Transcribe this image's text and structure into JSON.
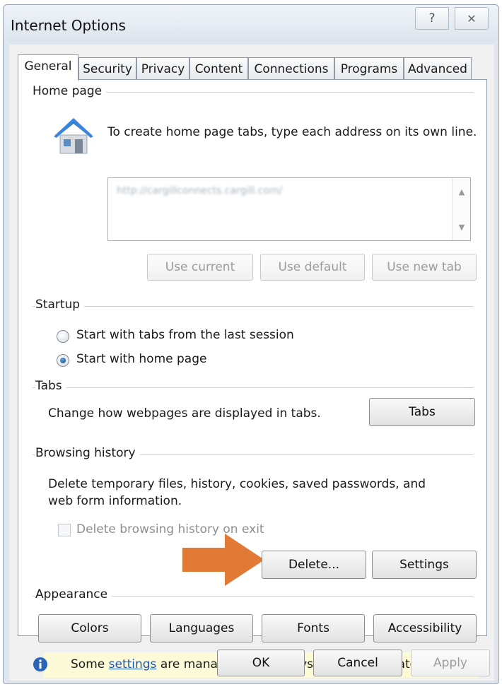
{
  "window": {
    "title": "Internet Options",
    "help_glyph": "?",
    "close_glyph": "✕"
  },
  "tabs": [
    {
      "label": "General",
      "active": true
    },
    {
      "label": "Security"
    },
    {
      "label": "Privacy"
    },
    {
      "label": "Content"
    },
    {
      "label": "Connections"
    },
    {
      "label": "Programs"
    },
    {
      "label": "Advanced"
    }
  ],
  "home_page": {
    "section_label": "Home page",
    "icon": "house-icon",
    "instruction": "To create home page tabs, type each address on its own line.",
    "url_value": "http://cargillconnects.cargill.com/",
    "buttons": {
      "use_current": "Use current",
      "use_default": "Use default",
      "use_new_tab": "Use new tab"
    }
  },
  "startup": {
    "section_label": "Startup",
    "options": [
      {
        "label": "Start with tabs from the last session",
        "checked": false
      },
      {
        "label": "Start with home page",
        "checked": true
      }
    ]
  },
  "tabs_section": {
    "section_label": "Tabs",
    "description": "Change how webpages are displayed in tabs.",
    "button": "Tabs"
  },
  "browsing_history": {
    "section_label": "Browsing history",
    "description_line1": "Delete temporary files, history, cookies, saved passwords, and",
    "description_line2": "web form information.",
    "checkbox_label": "Delete browsing history on exit",
    "checkbox_checked": false,
    "delete_button": "Delete...",
    "settings_button": "Settings"
  },
  "appearance": {
    "section_label": "Appearance",
    "buttons": {
      "colors": "Colors",
      "languages": "Languages",
      "fonts": "Fonts",
      "accessibility": "Accessibility"
    }
  },
  "info": {
    "prefix": "Some ",
    "link": "settings",
    "suffix": " are managed by your system administrator."
  },
  "footer": {
    "ok": "OK",
    "cancel": "Cancel",
    "apply": "Apply"
  },
  "colors": {
    "annotation_arrow": "#e07a35",
    "info_bar": "#fdfbd7",
    "link": "#1a55b4"
  }
}
